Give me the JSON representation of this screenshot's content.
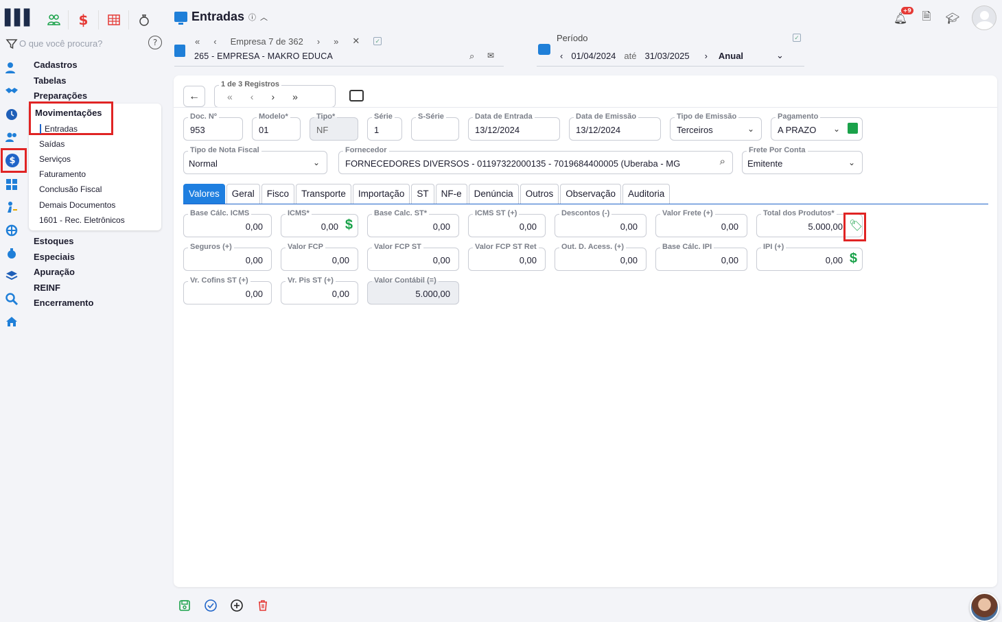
{
  "header": {
    "title": "Entradas",
    "info_icon": "info-icon",
    "notifications_badge": "+9"
  },
  "search": {
    "placeholder": "O que você procura?"
  },
  "menu": {
    "sections_top": [
      "Cadastros",
      "Tabelas",
      "Preparações"
    ],
    "active_section": "Movimentações",
    "sub_items": [
      "Entradas",
      "Saídas",
      "Serviços",
      "Faturamento",
      "Conclusão Fiscal",
      "Demais Documentos",
      "1601 - Rec. Eletrônicos"
    ],
    "sections_bottom": [
      "Estoques",
      "Especiais",
      "Apuração",
      "REINF",
      "Encerramento"
    ]
  },
  "company": {
    "nav_label": "Empresa 7 de 362",
    "name": "265 - EMPRESA - MAKRO EDUCA"
  },
  "periodo": {
    "label": "Período",
    "start": "01/04/2024",
    "separator": "até",
    "end": "31/03/2025",
    "mode": "Anual"
  },
  "records": {
    "label": "1 de 3 Registros"
  },
  "form": {
    "doc_label": "Doc. Nº",
    "doc_value": "953",
    "modelo_label": "Modelo*",
    "modelo_value": "01",
    "tipo_label": "Tipo*",
    "tipo_value": "NF",
    "serie_label": "Série",
    "serie_value": "1",
    "sserie_label": "S-Série",
    "sserie_value": "",
    "data_entrada_label": "Data de Entrada",
    "data_entrada_value": "13/12/2024",
    "data_emissao_label": "Data de Emissão",
    "data_emissao_value": "13/12/2024",
    "tipo_emissao_label": "Tipo de Emissão",
    "tipo_emissao_value": "Terceiros",
    "pagamento_label": "Pagamento",
    "pagamento_value": "A PRAZO",
    "tipo_nota_label": "Tipo de Nota Fiscal",
    "tipo_nota_value": "Normal",
    "fornecedor_label": "Fornecedor",
    "fornecedor_value": "FORNECEDORES DIVERSOS - 01197322000135 - 7019684400005 (Uberaba - MG",
    "frete_label": "Frete Por Conta",
    "frete_value": "Emitente"
  },
  "tabs": [
    "Valores",
    "Geral",
    "Fisco",
    "Transporte",
    "Importação",
    "ST",
    "NF-e",
    "Denúncia",
    "Outros",
    "Observação",
    "Auditoria"
  ],
  "valores": [
    {
      "label": "Base Cálc. ICMS",
      "value": "0,00"
    },
    {
      "label": "ICMS*",
      "value": "0,00"
    },
    {
      "label": "Base Calc. ST*",
      "value": "0,00"
    },
    {
      "label": "ICMS ST (+)",
      "value": "0,00"
    },
    {
      "label": "Descontos (-)",
      "value": "0,00"
    },
    {
      "label": "Valor Frete (+)",
      "value": "0,00"
    },
    {
      "label": "Total dos Produtos*",
      "value": "5.000,00"
    },
    {
      "label": "Seguros (+)",
      "value": "0,00"
    },
    {
      "label": "Valor FCP",
      "value": "0,00"
    },
    {
      "label": "Valor FCP ST",
      "value": "0,00"
    },
    {
      "label": "Valor FCP ST Ret",
      "value": "0,00"
    },
    {
      "label": "Out. D. Acess. (+)",
      "value": "0,00"
    },
    {
      "label": "Base Cálc. IPI",
      "value": "0,00"
    },
    {
      "label": "IPI (+)",
      "value": "0,00"
    },
    {
      "label": "Vr. Cofins ST (+)",
      "value": "0,00"
    },
    {
      "label": "Vr. Pis ST (+)",
      "value": "0,00"
    },
    {
      "label": "Valor Contábil (=)",
      "value": "5.000,00"
    }
  ],
  "colors": {
    "accent": "#1f7fe0",
    "highlight": "#e02424",
    "money": "#1aa24a"
  }
}
